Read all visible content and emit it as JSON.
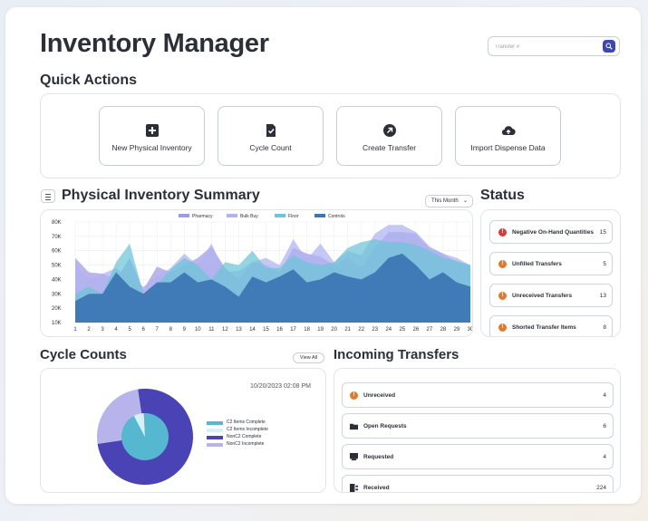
{
  "app": {
    "title": "Inventory Manager"
  },
  "search": {
    "placeholder": "Transfer #"
  },
  "quick_actions": {
    "title": "Quick Actions",
    "buttons": [
      {
        "label": "New Physical Inventory",
        "icon": "plus-box-icon"
      },
      {
        "label": "Cycle Count",
        "icon": "checklist-icon"
      },
      {
        "label": "Create Transfer",
        "icon": "arrow-up-right-circle-icon"
      },
      {
        "label": "Import Dispense Data",
        "icon": "cloud-upload-icon"
      }
    ]
  },
  "summary": {
    "title": "Physical Inventory Summary",
    "period": "This Month"
  },
  "chart_data": {
    "type": "area",
    "x": [
      1,
      2,
      3,
      4,
      5,
      6,
      7,
      8,
      9,
      10,
      11,
      12,
      13,
      14,
      15,
      16,
      17,
      18,
      19,
      20,
      21,
      22,
      23,
      24,
      25,
      26,
      27,
      28,
      29,
      30
    ],
    "ylim": [
      10000,
      80000
    ],
    "yticks": [
      "10K",
      "20K",
      "30K",
      "40K",
      "50K",
      "60K",
      "70K",
      "80K"
    ],
    "legend_position": "top-center",
    "grid": true,
    "series": [
      {
        "name": "Pharmacy",
        "color": "#9f9ae6",
        "values": [
          55,
          45,
          44,
          40,
          55,
          33,
          49,
          45,
          50,
          55,
          63,
          48,
          40,
          52,
          50,
          45,
          62,
          58,
          56,
          50,
          55,
          48,
          62,
          73,
          73,
          72,
          62,
          58,
          52,
          50
        ]
      },
      {
        "name": "Bulk Buy",
        "color": "#aeb2f0",
        "values": [
          50,
          40,
          44,
          48,
          40,
          35,
          42,
          48,
          58,
          50,
          65,
          45,
          46,
          52,
          55,
          50,
          68,
          54,
          65,
          52,
          60,
          57,
          72,
          78,
          78,
          73,
          63,
          58,
          55,
          50
        ]
      },
      {
        "name": "Floor",
        "color": "#6cc5d8",
        "values": [
          30,
          35,
          30,
          52,
          65,
          30,
          36,
          47,
          55,
          50,
          40,
          52,
          50,
          60,
          48,
          48,
          57,
          52,
          50,
          52,
          62,
          66,
          68,
          66,
          66,
          64,
          60,
          55,
          53,
          50
        ]
      },
      {
        "name": "Controls",
        "color": "#3b75b4",
        "values": [
          25,
          30,
          30,
          45,
          35,
          30,
          38,
          38,
          45,
          38,
          40,
          35,
          28,
          42,
          38,
          42,
          47,
          38,
          40,
          45,
          42,
          40,
          45,
          55,
          58,
          50,
          40,
          45,
          38,
          35
        ]
      }
    ]
  },
  "status": {
    "title": "Status",
    "items": [
      {
        "label": "Negative On-Hand Quantities",
        "count": "15",
        "color": "#d93a3a",
        "glyph": "!"
      },
      {
        "label": "Unfilled Transfers",
        "count": "5",
        "color": "#e07b2e",
        "glyph": "!"
      },
      {
        "label": "Unreceived Transfers",
        "count": "13",
        "color": "#e07b2e",
        "glyph": "!"
      },
      {
        "label": "Shorted Transfer Items",
        "count": "8",
        "color": "#e07b2e",
        "glyph": "!"
      }
    ]
  },
  "cycle_counts": {
    "title": "Cycle Counts",
    "view_all": "View All",
    "timestamp": "10/20/2023 02:08 PM",
    "pie": {
      "outer": [
        {
          "name": "NonC2 Complete",
          "value": 75,
          "color": "#4a43b5"
        },
        {
          "name": "NonC2 Incomplete",
          "value": 25,
          "color": "#b7b4ec"
        }
      ],
      "inner": [
        {
          "name": "C2 Items Complete",
          "value": 93,
          "color": "#55b8d0"
        },
        {
          "name": "C2 Items Incomplete",
          "value": 7,
          "color": "#d6f1f6"
        }
      ]
    },
    "legend": [
      {
        "label": "C2 Items Complete",
        "color": "#55b8d0"
      },
      {
        "label": "C2 Items Incomplete",
        "color": "#d6f1f6"
      },
      {
        "label": "NonC2 Complete",
        "color": "#4a43b5"
      },
      {
        "label": "NonC2 Incomplete",
        "color": "#b7b4ec"
      }
    ]
  },
  "incoming": {
    "title": "Incoming Transfers",
    "items": [
      {
        "label": "Unreceived",
        "count": "4",
        "icon": "alert-icon"
      },
      {
        "label": "Open Requests",
        "count": "6",
        "icon": "folder-open-icon"
      },
      {
        "label": "Requested",
        "count": "4",
        "icon": "inbox-icon"
      },
      {
        "label": "Received",
        "count": "224",
        "icon": "received-icon"
      }
    ]
  }
}
